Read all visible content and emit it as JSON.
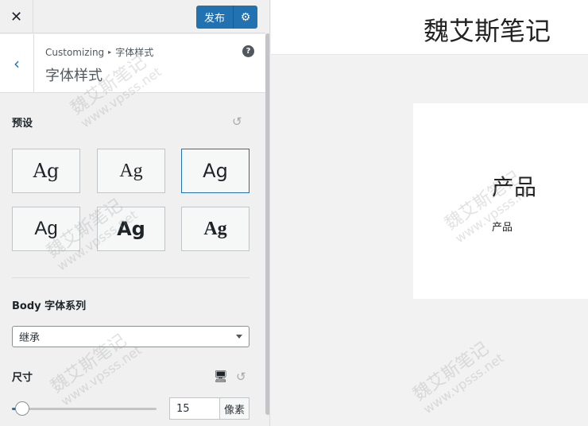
{
  "topbar": {
    "close_glyph": "✕",
    "publish_label": "发布",
    "settings_glyph": "⚙"
  },
  "section": {
    "back_glyph": "‹",
    "breadcrumb_root": "Customizing",
    "breadcrumb_sep": "▸",
    "breadcrumb_current": "字体样式",
    "title": "字体样式",
    "help_glyph": "?"
  },
  "presets": {
    "label": "预设",
    "reset_glyph": "↺",
    "items": [
      {
        "label": "Ag",
        "selected": false
      },
      {
        "label": "Ag",
        "selected": false
      },
      {
        "label": "Ag",
        "selected": true
      },
      {
        "label": "Ag",
        "selected": false
      },
      {
        "label": "Ag",
        "selected": false
      },
      {
        "label": "Ag",
        "selected": false
      }
    ]
  },
  "body_font": {
    "label": "Body 字体系列",
    "value": "继承"
  },
  "size": {
    "label": "尺寸",
    "device_glyph": "🖥",
    "reset_glyph": "↺",
    "value": "15",
    "unit": "像素",
    "slider_fraction": 0.07
  },
  "preview": {
    "site_title": "魏艾斯笔记",
    "card_title": "产品",
    "card_text": "产品"
  },
  "watermark": {
    "text": "魏艾斯笔记",
    "sub": "www.vpsss.net"
  },
  "colors": {
    "accent": "#2271b1",
    "sidebar_bg": "#f0f0f1",
    "preview_bg": "#f2f2f2"
  }
}
